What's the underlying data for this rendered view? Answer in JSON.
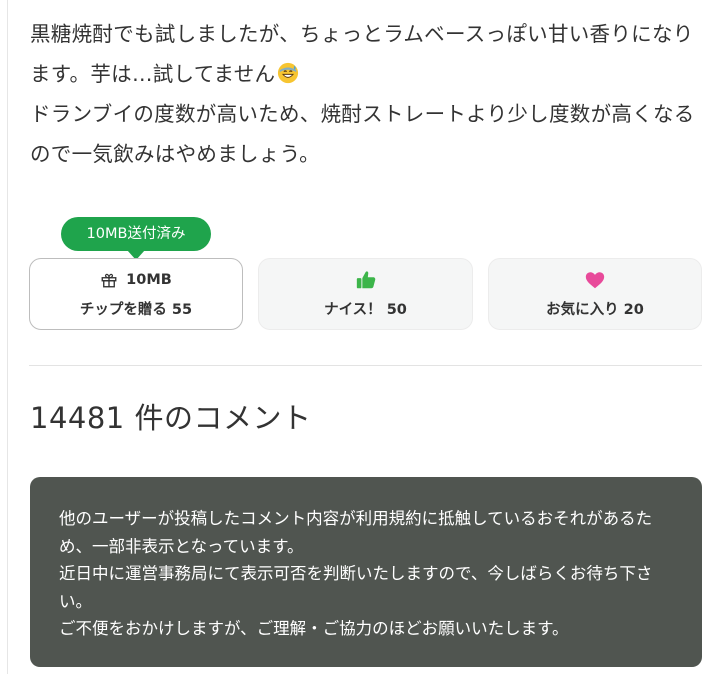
{
  "article": {
    "paragraph1": "黒糖焼酎でも試しましたが、ちょっとラムベースっぽい甘い香りになります。芋は…試してません",
    "paragraph2": "ドランブイの度数が高いため、焼酎ストレートより少し度数が高くなるので一気飲みはやめましょう。",
    "emoji_icon": "grinning-sweat-emoji-icon"
  },
  "reactions": {
    "sent_badge": "10MB送付済み",
    "tip": {
      "icon": "gift-icon",
      "amount": "10MB",
      "label": "チップを贈る 55"
    },
    "nice": {
      "icon": "thumbs-up-icon",
      "label": "ナイス！ 50"
    },
    "favorite": {
      "icon": "heart-icon",
      "label": "お気に入り 20"
    },
    "colors": {
      "green": "#1fa44c",
      "thumb_green": "#3cb54a",
      "heart_pink": "#e84a9a"
    }
  },
  "comments": {
    "heading": "14481 件のコメント",
    "notice": {
      "line1": "他のユーザーが投稿したコメント内容が利用規約に抵触しているおそれがあるため、一部非表示となっています。",
      "line2": "近日中に運営事務局にて表示可否を判断いたしますので、今しばらくお待ち下さい。",
      "line3": "ご不便をおかけしますが、ご理解・ご協力のほどお願いいたします。",
      "background": "#505550"
    }
  }
}
